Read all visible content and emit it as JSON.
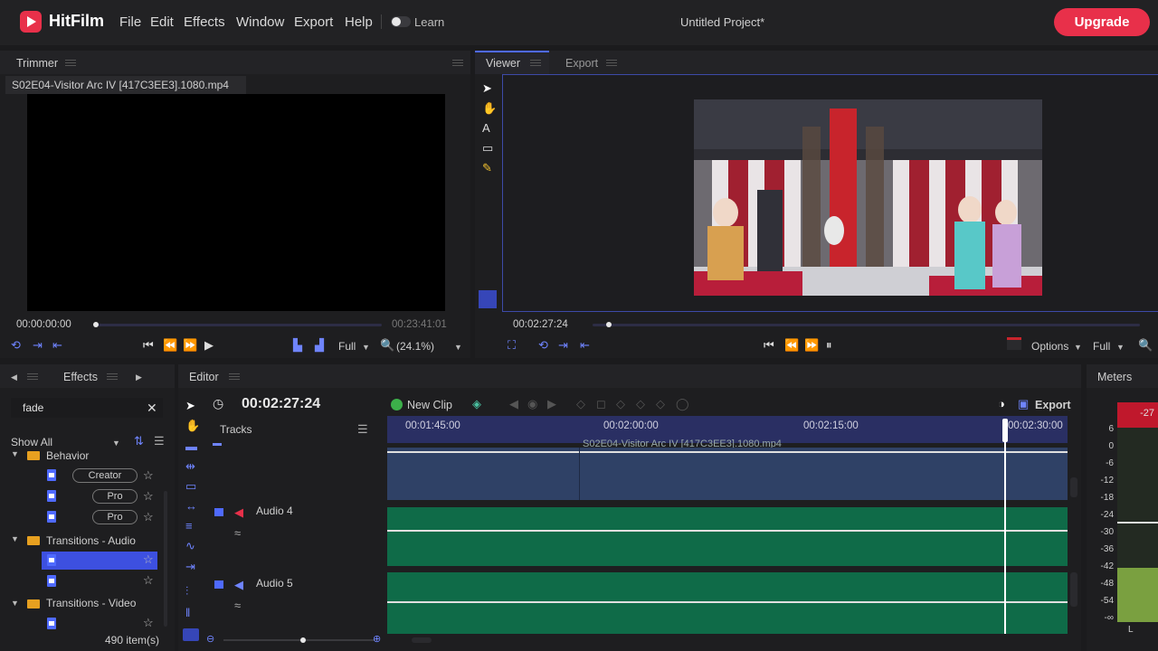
{
  "app": {
    "name": "HitFilm",
    "project_title": "Untitled Project*",
    "upgrade_label": "Upgrade",
    "learn_label": "Learn",
    "menu": [
      "File",
      "Edit",
      "Effects",
      "Window",
      "Export",
      "Help"
    ]
  },
  "trimmer": {
    "tab": "Trimmer",
    "filename": "S02E04-Visitor Arc IV [417C3EE3].1080.mp4",
    "current_time": "00:00:00:00",
    "duration": "00:23:41:01",
    "quality": "Full",
    "zoom": "(24.1%)",
    "progress": 0.0
  },
  "viewer": {
    "tab": "Viewer",
    "export_tab": "Export",
    "current_time": "00:02:27:24",
    "options_label": "Options",
    "quality": "Full",
    "progress": 0.03
  },
  "effects": {
    "tab": "Effects",
    "search_value": "fade",
    "filter": "Show All",
    "item_count": "490 item(s)",
    "folders": [
      {
        "name": "Behavior"
      },
      {
        "name": "Transitions - Audio"
      },
      {
        "name": "Transitions - Video"
      }
    ],
    "badges": [
      "Creator",
      "Pro",
      "Pro"
    ]
  },
  "editor": {
    "tab": "Editor",
    "timecode": "00:02:27:24",
    "new_clip_label": "New Clip",
    "export_label": "Export",
    "tracks_label": "Tracks",
    "ruler": [
      "00:01:45:00",
      "00:02:00:00",
      "00:02:15:00",
      "00:02:30:00"
    ],
    "video_clip_text": "S02E04-Visitor Arc IV [417C3EE3].1080.mp4",
    "audio_tracks": [
      "Audio 4",
      "Audio 5"
    ]
  },
  "meters": {
    "tab": "Meters",
    "peak": "-27",
    "scale": [
      "6",
      "0",
      "-6",
      "-12",
      "-18",
      "-24",
      "-30",
      "-36",
      "-42",
      "-48",
      "-54",
      "-∞"
    ],
    "level": 0.28,
    "footer": "L"
  },
  "colors": {
    "accent": "#e8304a",
    "blue": "#4f6aff",
    "audio_track": "#0f6b48",
    "video_track": "#2f4166"
  }
}
